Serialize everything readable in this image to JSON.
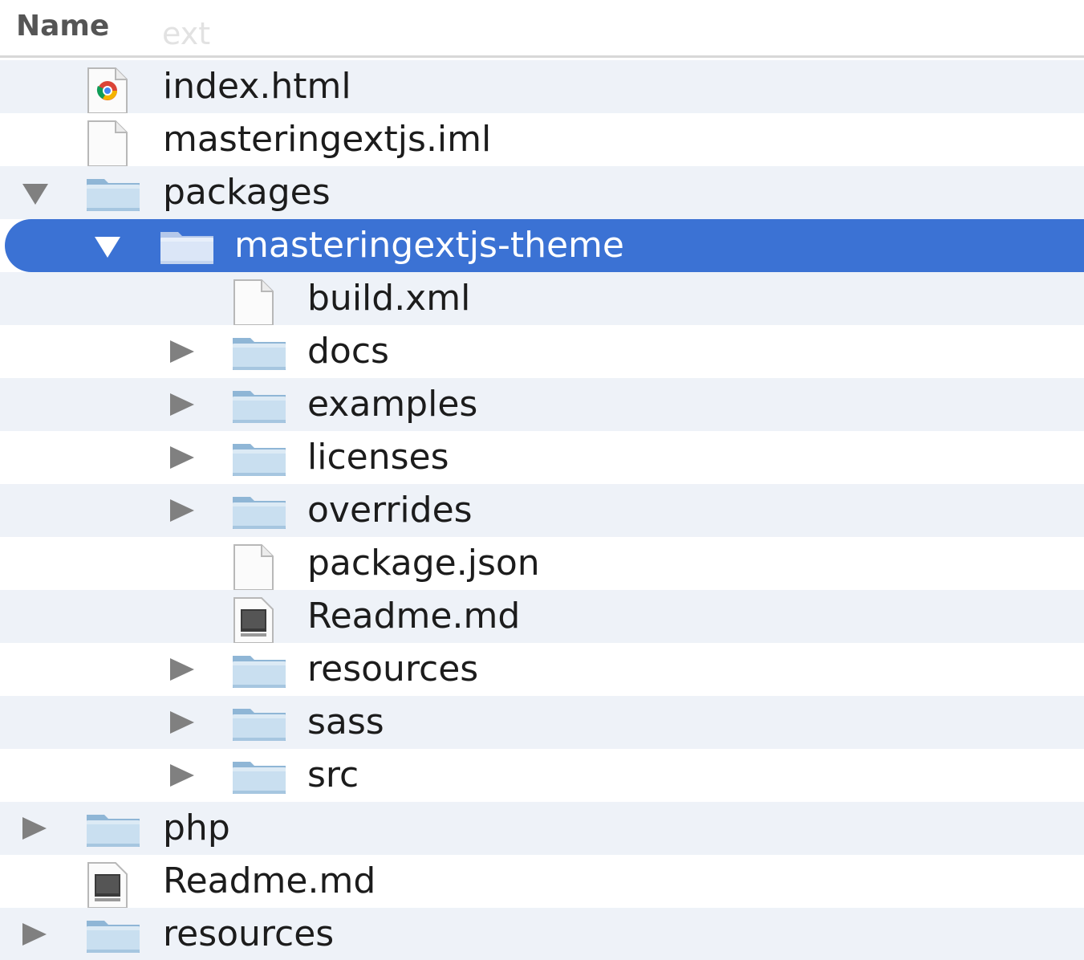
{
  "header": {
    "name_column": "Name",
    "scrolled_ghost_text": "ext"
  },
  "rows": [
    {
      "label": "index.html",
      "type": "file",
      "icon": "chrome-html-file-icon",
      "depth": 1,
      "expanded": null
    },
    {
      "label": "masteringextjs.iml",
      "type": "file",
      "icon": "document-file-icon",
      "depth": 1,
      "expanded": null
    },
    {
      "label": "packages",
      "type": "folder",
      "icon": "folder-icon",
      "depth": 1,
      "expanded": true
    },
    {
      "label": "masteringextjs-theme",
      "type": "folder",
      "icon": "folder-icon",
      "depth": 2,
      "expanded": true,
      "selected": true
    },
    {
      "label": "build.xml",
      "type": "file",
      "icon": "document-file-icon",
      "depth": 3,
      "expanded": null
    },
    {
      "label": "docs",
      "type": "folder",
      "icon": "folder-icon",
      "depth": 3,
      "expanded": false
    },
    {
      "label": "examples",
      "type": "folder",
      "icon": "folder-icon",
      "depth": 3,
      "expanded": false
    },
    {
      "label": "licenses",
      "type": "folder",
      "icon": "folder-icon",
      "depth": 3,
      "expanded": false
    },
    {
      "label": "overrides",
      "type": "folder",
      "icon": "folder-icon",
      "depth": 3,
      "expanded": false
    },
    {
      "label": "package.json",
      "type": "file",
      "icon": "document-file-icon",
      "depth": 3,
      "expanded": null
    },
    {
      "label": "Readme.md",
      "type": "file",
      "icon": "markdown-file-icon",
      "depth": 3,
      "expanded": null
    },
    {
      "label": "resources",
      "type": "folder",
      "icon": "folder-icon",
      "depth": 3,
      "expanded": false
    },
    {
      "label": "sass",
      "type": "folder",
      "icon": "folder-icon",
      "depth": 3,
      "expanded": false
    },
    {
      "label": "src",
      "type": "folder",
      "icon": "folder-icon",
      "depth": 3,
      "expanded": false
    },
    {
      "label": "php",
      "type": "folder",
      "icon": "folder-icon",
      "depth": 1,
      "expanded": false
    },
    {
      "label": "Readme.md",
      "type": "file",
      "icon": "markdown-file-icon",
      "depth": 1,
      "expanded": null
    },
    {
      "label": "resources",
      "type": "folder",
      "icon": "folder-icon",
      "depth": 1,
      "expanded": false
    }
  ],
  "colors": {
    "selection": "#3b72d4",
    "stripe": "#eef2f8",
    "folder_light": "#c9dff0",
    "folder_dark": "#8fb6d6"
  }
}
